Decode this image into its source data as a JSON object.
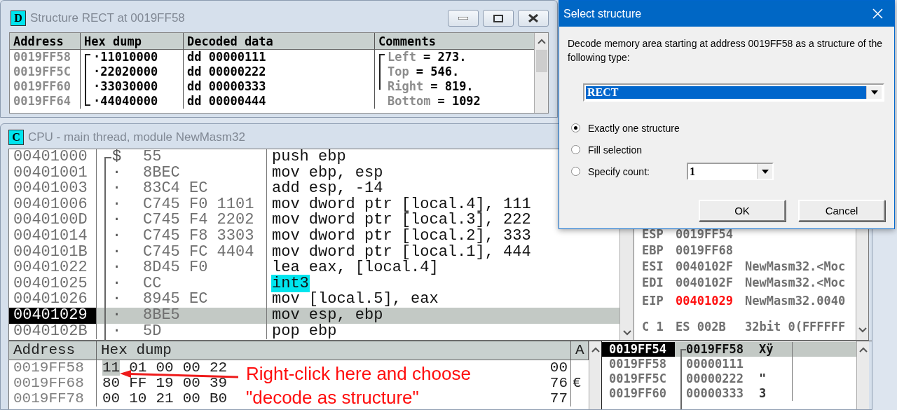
{
  "structure_window": {
    "icon_letter": "D",
    "title": "Structure RECT at 0019FF58",
    "columns": [
      "Address",
      "Hex dump",
      "Decoded data",
      "Comments"
    ],
    "rows": [
      {
        "address": "0019FF58",
        "hex_dump": "·11010000",
        "decoded": "dd 00000111",
        "comment_label": "Left",
        "comment_value": "= 273."
      },
      {
        "address": "0019FF5C",
        "hex_dump": "·22020000",
        "decoded": "dd 00000222",
        "comment_label": "Top",
        "comment_value": "= 546."
      },
      {
        "address": "0019FF60",
        "hex_dump": "·33030000",
        "decoded": "dd 00000333",
        "comment_label": "Right",
        "comment_value": "= 819."
      },
      {
        "address": "0019FF64",
        "hex_dump": "·44040000",
        "decoded": "dd 00000444",
        "comment_label": "Bottom",
        "comment_value": "= 1092"
      }
    ]
  },
  "cpu_window": {
    "icon_letter": "C",
    "title": "CPU - main thread, module NewMasm32",
    "disassembly": [
      {
        "address": "00401000",
        "marker": "$",
        "hex": "55",
        "command": "push ebp",
        "selected": false,
        "highlighted": false
      },
      {
        "address": "00401001",
        "marker": "·",
        "hex": "8BEC",
        "command": "mov ebp, esp",
        "selected": false,
        "highlighted": false
      },
      {
        "address": "00401003",
        "marker": "·",
        "hex": "83C4 EC",
        "command": "add esp, -14",
        "selected": false,
        "highlighted": false
      },
      {
        "address": "00401006",
        "marker": "·",
        "hex": "C745 F0 1101",
        "command": "mov dword ptr [local.4], 111",
        "selected": false,
        "highlighted": false
      },
      {
        "address": "0040100D",
        "marker": "·",
        "hex": "C745 F4 2202",
        "command": "mov dword ptr [local.3], 222",
        "selected": false,
        "highlighted": false
      },
      {
        "address": "00401014",
        "marker": "·",
        "hex": "C745 F8 3303",
        "command": "mov dword ptr [local.2], 333",
        "selected": false,
        "highlighted": false
      },
      {
        "address": "0040101B",
        "marker": "·",
        "hex": "C745 FC 4404",
        "command": "mov dword ptr [local.1], 444",
        "selected": false,
        "highlighted": false
      },
      {
        "address": "00401022",
        "marker": "·",
        "hex": "8D45 F0",
        "command": "lea eax, [local.4]",
        "selected": false,
        "highlighted": false
      },
      {
        "address": "00401025",
        "marker": "·",
        "hex": "CC",
        "command": "int3",
        "selected": false,
        "highlighted": true
      },
      {
        "address": "00401026",
        "marker": "·",
        "hex": "8945 EC",
        "command": "mov [local.5], eax",
        "selected": false,
        "highlighted": false
      },
      {
        "address": "00401029",
        "marker": "·",
        "hex": "8BE5",
        "command": "mov esp, ebp",
        "selected": true,
        "highlighted": false
      },
      {
        "address": "0040102B",
        "marker": "·",
        "hex": "5D",
        "command": "pop ebp",
        "selected": false,
        "highlighted": false
      }
    ],
    "registers": [
      {
        "kind": "general",
        "name": "ESP",
        "value": "0019FF54",
        "changed": false
      },
      {
        "kind": "general",
        "name": "EBP",
        "value": "0019FF68",
        "changed": false
      },
      {
        "kind": "general",
        "name": "ESI",
        "value": "0040102F",
        "comment": "NewMasm32.<Moc",
        "changed": false
      },
      {
        "kind": "general",
        "name": "EDI",
        "value": "0040102F",
        "comment": "NewMasm32.<Moc",
        "changed": false
      },
      {
        "kind": "instruction_pointer",
        "name": "EIP",
        "value": "00401029",
        "comment": "NewMasm32.0040",
        "changed": true
      },
      {
        "kind": "segment",
        "name": "C 1",
        "value": "ES 002B",
        "comment": "32bit 0(FFFFFF",
        "changed": false
      }
    ],
    "dump": {
      "columns": [
        "Address",
        "Hex dump",
        "A"
      ],
      "rows": [
        {
          "address": "0019FF58",
          "bytes": [
            {
              "text": "11",
              "selected": true
            },
            {
              "text": "01",
              "selected": false
            },
            {
              "text": "00",
              "selected": false
            },
            {
              "text": "00",
              "selected": false
            },
            {
              "text": "22",
              "selected": false
            }
          ],
          "tail": "00"
        },
        {
          "address": "0019FF68",
          "bytes": [
            {
              "text": "80",
              "selected": false
            },
            {
              "text": "FF",
              "selected": false
            },
            {
              "text": "19",
              "selected": false
            },
            {
              "text": "00",
              "selected": false
            },
            {
              "text": "39",
              "selected": false
            }
          ],
          "tail": "76",
          "ascii": "€"
        },
        {
          "address": "0019FF78",
          "bytes": [
            {
              "text": "00",
              "selected": false
            },
            {
              "text": "10",
              "selected": false
            },
            {
              "text": "21",
              "selected": false
            },
            {
              "text": "00",
              "selected": false
            },
            {
              "text": "B0",
              "selected": false
            }
          ],
          "tail": "77"
        }
      ]
    },
    "stack": [
      {
        "address": "0019FF54",
        "value": "0019FF58",
        "ascii": "Xÿ",
        "selected": true
      },
      {
        "address": "0019FF58",
        "value": "00000111",
        "selected": false
      },
      {
        "address": "0019FF5C",
        "value": "00000222",
        "ascii": "\"",
        "selected": false
      },
      {
        "address": "0019FF60",
        "value": "00000333",
        "ascii": "3",
        "selected": false
      }
    ]
  },
  "dialog": {
    "title": "Select structure",
    "description": "Decode memory area starting at address 0019FF58 as a structure of the following type:",
    "type_combo": {
      "value": "RECT"
    },
    "options": [
      {
        "label": "Exactly one structure",
        "selected": true
      },
      {
        "label": "Fill selection",
        "selected": false
      },
      {
        "label": "Specify count:",
        "selected": false
      }
    ],
    "count_combo": {
      "value": "1"
    },
    "buttons": [
      "OK",
      "Cancel"
    ]
  },
  "annotation": {
    "lines": [
      "Right-click here and choose",
      "\"decode as structure\""
    ]
  }
}
